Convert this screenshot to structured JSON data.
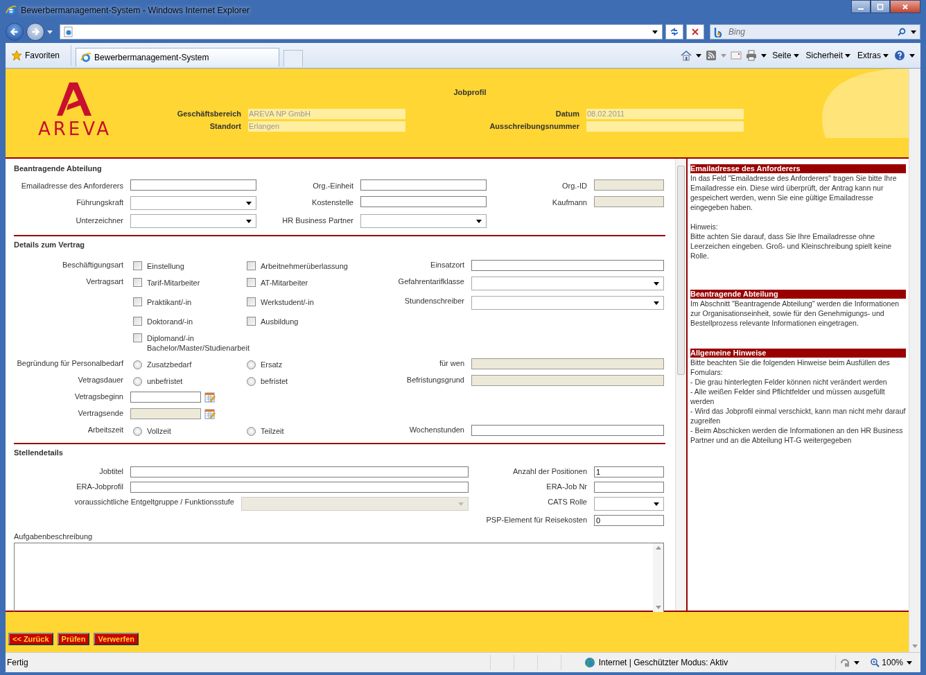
{
  "browser": {
    "title": "Bewerbermanagement-System - Windows Internet Explorer",
    "search_placeholder": "Bing",
    "favorites": "Favoriten",
    "tab_title": "Bewerbermanagement-System",
    "commands": [
      "Seite",
      "Sicherheit",
      "Extras"
    ],
    "status": "Fertig",
    "zone": "Internet | Geschützter Modus: Aktiv",
    "zoom": "100%"
  },
  "header": {
    "logo_text": "AREVA",
    "title": "Jobprofil",
    "fields": [
      {
        "label": "Geschäftsbereich",
        "value": "AREVA NP GmbH"
      },
      {
        "label": "Datum",
        "value": "08.02.2011"
      },
      {
        "label": "Standort",
        "value": "Erlangen"
      },
      {
        "label": "Ausschreibungsnummer"
      }
    ]
  },
  "department": {
    "title": "Beantragende Abteilung",
    "rows": [
      [
        {
          "label": "Emailadresse des Anforderers",
          "kind": "text"
        },
        {
          "label": "Org.-Einheit",
          "kind": "text"
        },
        {
          "label": "Org.-ID",
          "kind": "readonly"
        }
      ],
      [
        {
          "label": "Führungskraft",
          "kind": "select"
        },
        {
          "label": "Kostenstelle",
          "kind": "text"
        },
        {
          "label": "Kaufmann",
          "kind": "readonly"
        }
      ],
      [
        {
          "label": "Unterzeichner",
          "kind": "select"
        },
        {
          "label": "HR Business Partner",
          "kind": "select"
        }
      ]
    ]
  },
  "contract": {
    "title": "Details zum Vertrag",
    "rows": [
      {
        "label": "Beschäftigungsart",
        "kind": "choices",
        "options": [
          {
            "label": "Einstellung",
            "kind": "checkbox",
            "checked": false
          },
          {
            "label": "Arbeitnehmerüberlassung",
            "kind": "checkbox",
            "checked": false
          }
        ],
        "field": {
          "label": "Einsatzort",
          "kind": "text"
        }
      },
      {
        "label": "Vertragsart",
        "kind": "choices",
        "options": [
          {
            "label": "Tarif-Mitarbeiter",
            "kind": "checkbox",
            "checked": false
          },
          {
            "label": "AT-Mitarbeiter",
            "kind": "checkbox",
            "checked": false
          }
        ],
        "field": {
          "label": "Gefahrentarifklasse",
          "kind": "select"
        }
      },
      {
        "kind": "choices",
        "options": [
          {
            "label": "Praktikant/-in",
            "kind": "checkbox",
            "checked": false
          },
          {
            "label": "Werkstudent/-in",
            "kind": "checkbox",
            "checked": false
          }
        ],
        "field": {
          "label": "Stundenschreiber",
          "kind": "select"
        }
      },
      {
        "kind": "choices",
        "options": [
          {
            "label": "Doktorand/-in",
            "kind": "checkbox",
            "checked": false
          },
          {
            "label": "Ausbildung",
            "kind": "checkbox",
            "checked": false
          }
        ]
      },
      {
        "kind": "choices",
        "options": [
          {
            "label": "Diplomand/-in Bachelor/Master/Studienarbeit",
            "kind": "checkbox",
            "checked": false
          }
        ]
      },
      {
        "label": "Begründung für Personalbedarf",
        "kind": "choices",
        "options": [
          {
            "label": "Zusatzbedarf",
            "kind": "radio",
            "checked": false
          },
          {
            "label": "Ersatz",
            "kind": "radio",
            "checked": false
          }
        ],
        "field": {
          "label": "für wen",
          "kind": "readonly"
        }
      },
      {
        "label": "Vetragsdauer",
        "kind": "choices",
        "options": [
          {
            "label": "unbefristet",
            "kind": "radio",
            "checked": false
          },
          {
            "label": "befristet",
            "kind": "radio",
            "checked": false
          }
        ],
        "field": {
          "label": "Befristungsgrund",
          "kind": "readonly"
        }
      },
      {
        "label": "Vetragsbeginn",
        "kind": "date",
        "input": {
          "kind": "text"
        }
      },
      {
        "label": "Vertragsende",
        "kind": "date",
        "input": {
          "kind": "readonly"
        }
      },
      {
        "label": "Arbeitszeit",
        "kind": "choices",
        "options": [
          {
            "label": "Vollzeit",
            "kind": "radio",
            "checked": false
          },
          {
            "label": "Teilzeit",
            "kind": "radio",
            "checked": false
          }
        ],
        "field": {
          "label": "Wochenstunden",
          "kind": "text"
        }
      }
    ]
  },
  "position": {
    "title": "Stellendetails",
    "rows": [
      {
        "left": {
          "label": "Jobtitel",
          "kind": "text"
        },
        "right": {
          "label": "Anzahl der Positionen",
          "kind": "text",
          "value": "1"
        }
      },
      {
        "left": {
          "label": "ERA-Jobprofil",
          "kind": "text"
        },
        "right": {
          "label": "ERA-Job Nr",
          "kind": "text"
        }
      },
      {
        "left": {
          "label": "voraussichtliche Entgeltgruppe / Funktionsstufe",
          "kind": "readonly-select"
        },
        "right": {
          "label": "CATS Rolle",
          "kind": "select"
        }
      },
      {
        "right": {
          "label": "PSP-Element für Reisekosten",
          "kind": "text",
          "value": "0"
        }
      }
    ],
    "description_label": "Aufgabenbeschreibung"
  },
  "help": [
    {
      "title": "Emailadresse des Anforderers",
      "paragraphs": [
        [
          "In das Feld \"Emailadresse des Anforderers\" tragen Sie bitte Ihre Emailadresse ein. Diese wird überprüft, der Antrag kann nur gespeichert werden, wenn Sie eine gültige Emailadresse eingegeben haben."
        ],
        [
          "Hinweis:",
          "Bitte achten Sie darauf, dass Sie Ihre Emailadresse ohne Leerzeichen eingeben. Groß- und Kleinschreibung spielt keine Rolle."
        ]
      ]
    },
    {
      "title": "Beantragende Abteilung",
      "paragraphs": [
        [
          "Im Abschnitt \"Beantragende Abteilung\" werden die Informationen zur Organisationseinheit, sowie für den Genehmigungs- und Bestellprozess relevante Informationen eingetragen."
        ]
      ]
    },
    {
      "title": "Allgemeine Hinweise",
      "paragraphs": [
        [
          "Bitte beachten Sie die folgenden Hinweise beim Ausfüllen des Fomulars:",
          "- Die grau hinterlegten Felder können nicht verändert werden",
          "- Alle weißen Felder sind Pflichtfelder und müssen ausgefüllt werden",
          "- Wird das Jobprofil einmal verschickt, kann man nicht mehr darauf zugreifen",
          "- Beim Abschicken werden die Informationen an den HR Business Partner und an die Abteilung HT-G weitergegeben"
        ]
      ]
    }
  ],
  "buttons": [
    "<< Zurück",
    "Prüfen",
    "Verwerfen"
  ]
}
